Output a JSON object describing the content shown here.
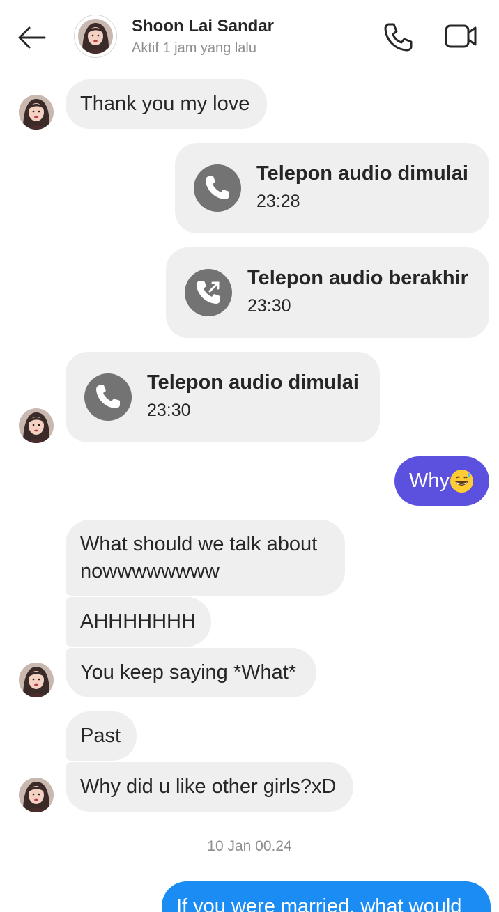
{
  "header": {
    "contact_name": "Shoon Lai Sandar",
    "status": "Aktif 1 jam yang lalu",
    "back_icon": "arrow-left-icon",
    "call_icon": "phone-icon",
    "video_icon": "video-camera-icon"
  },
  "messages": {
    "m1": "Thank you my love",
    "call1": {
      "title": "Telepon audio dimulai",
      "time": "23:28"
    },
    "call2": {
      "title": "Telepon audio berakhir",
      "time": "23:30"
    },
    "call3": {
      "title": "Telepon audio dimulai",
      "time": "23:30"
    },
    "m2": "Why",
    "m3_line1": "What should we talk about",
    "m3_line2": "nowwwwwwww",
    "m4": "AHHHHHHH",
    "m5": "You keep saying *What*",
    "m6": "Past",
    "m7": "Why did u like other girls?xD",
    "date_divider": "10 Jan 00.24",
    "m8": "If you were married, what would"
  },
  "colors": {
    "incoming_bubble": "#efefef",
    "outgoing_purple": "#5b51de",
    "outgoing_blue": "#1a8cf4",
    "call_icon_bg": "#737373",
    "secondary_text": "#8e8e8e"
  },
  "emoji": "grinning-sweat-emoji"
}
